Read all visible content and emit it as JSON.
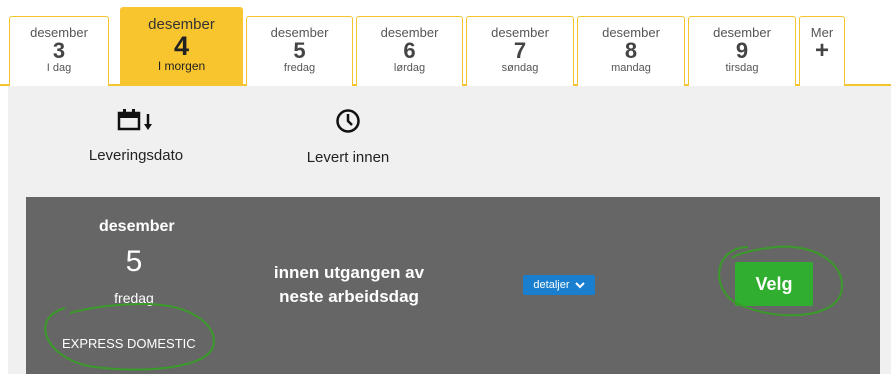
{
  "tabs": [
    {
      "month": "desember",
      "day": "3",
      "label": "I dag",
      "active": false
    },
    {
      "month": "desember",
      "day": "4",
      "label": "I morgen",
      "active": true
    },
    {
      "month": "desember",
      "day": "5",
      "label": "fredag",
      "active": false
    },
    {
      "month": "desember",
      "day": "6",
      "label": "lørdag",
      "active": false
    },
    {
      "month": "desember",
      "day": "7",
      "label": "søndag",
      "active": false
    },
    {
      "month": "desember",
      "day": "8",
      "label": "mandag",
      "active": false
    },
    {
      "month": "desember",
      "day": "9",
      "label": "tirsdag",
      "active": false
    }
  ],
  "more": {
    "label": "Mer",
    "icon": "+"
  },
  "filters": {
    "delivery_date": "Leveringsdato",
    "delivered_within": "Levert innen"
  },
  "option": {
    "month": "desember",
    "day": "5",
    "weekday": "fredag",
    "product": "EXPRESS DOMESTIC",
    "delivery_text": "innen utgangen av neste arbeidsdag",
    "details_label": "detaljer",
    "select_label": "Velg"
  },
  "colors": {
    "accent": "#f9c52f",
    "panel": "#666666",
    "select": "#2fae2f",
    "details": "#1a7fcf",
    "annotation": "#3a9a2a"
  }
}
